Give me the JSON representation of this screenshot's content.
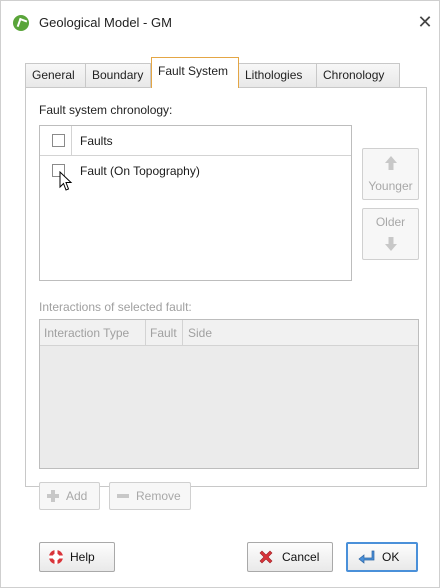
{
  "window": {
    "title": "Geological Model - GM",
    "app_icon": "leapfrog-app-icon",
    "close_glyph": "✕"
  },
  "tabs": [
    {
      "label": "General",
      "active": false
    },
    {
      "label": "Boundary",
      "active": false
    },
    {
      "label": "Fault System",
      "active": true
    },
    {
      "label": "Lithologies",
      "active": false
    },
    {
      "label": "Chronology",
      "active": false
    }
  ],
  "fault_system": {
    "chronology_label": "Fault system chronology:",
    "table_header": "Faults",
    "rows": [
      {
        "label": "Fault (On Topography)",
        "checked": false
      }
    ],
    "younger_label": "Younger",
    "older_label": "Older"
  },
  "interactions": {
    "label": "Interactions of selected fault:",
    "columns": [
      "Interaction Type",
      "Fault",
      "Side"
    ],
    "add_label": "Add",
    "remove_label": "Remove"
  },
  "footer": {
    "help_label": "Help",
    "cancel_label": "Cancel",
    "ok_label": "OK"
  },
  "colors": {
    "active_tab_border": "#e4a645",
    "default_button_border": "#4a90d9",
    "disabled_text": "#a0a0a0"
  }
}
